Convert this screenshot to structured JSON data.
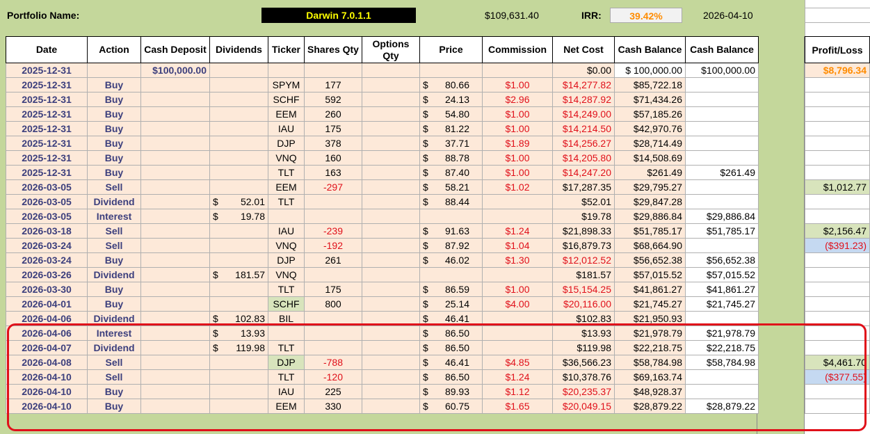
{
  "header": {
    "portfolio_label": "Portfolio Name:",
    "portfolio_name": "Darwin 7.0.1.1",
    "total_value": "$109,631.40",
    "irr_label": "IRR:",
    "irr_value": "39.42%",
    "as_of_date": "2026-04-10"
  },
  "columns": {
    "date": "Date",
    "action": "Action",
    "cash_deposit": "Cash Deposit",
    "dividends": "Dividends",
    "ticker": "Ticker",
    "shares": "Shares Qty",
    "options": "Options Qty",
    "price": "Price",
    "commission": "Commission",
    "net_cost": "Net Cost",
    "cash_balance1": "Cash Balance",
    "cash_balance2": "Cash Balance",
    "profit_loss": "Profit/Loss"
  },
  "rows": [
    {
      "date": "2025-12-31",
      "action": "",
      "deposit": "$100,000.00",
      "div": "",
      "div_amt": "",
      "ticker": "",
      "shares": "",
      "options": "",
      "price": "",
      "commission": "",
      "net_cost": "$0.00",
      "cash1": "$ 100,000.00",
      "cash2": "$100,000.00",
      "pl": "$8,796.34",
      "pl_type": "orange"
    },
    {
      "date": "2025-12-31",
      "action": "Buy",
      "deposit": "",
      "div": "",
      "div_amt": "",
      "ticker": "SPYM",
      "shares": "177",
      "options": "",
      "price": "80.66",
      "commission": "$1.00",
      "net_cost": "$14,277.82",
      "cash1": "$85,722.18",
      "cash2": "",
      "pl": "",
      "pl_type": ""
    },
    {
      "date": "2025-12-31",
      "action": "Buy",
      "deposit": "",
      "div": "",
      "div_amt": "",
      "ticker": "SCHF",
      "shares": "592",
      "options": "",
      "price": "24.13",
      "commission": "$2.96",
      "net_cost": "$14,287.92",
      "cash1": "$71,434.26",
      "cash2": "",
      "pl": "",
      "pl_type": ""
    },
    {
      "date": "2025-12-31",
      "action": "Buy",
      "deposit": "",
      "div": "",
      "div_amt": "",
      "ticker": "EEM",
      "shares": "260",
      "options": "",
      "price": "54.80",
      "commission": "$1.00",
      "net_cost": "$14,249.00",
      "cash1": "$57,185.26",
      "cash2": "",
      "pl": "",
      "pl_type": ""
    },
    {
      "date": "2025-12-31",
      "action": "Buy",
      "deposit": "",
      "div": "",
      "div_amt": "",
      "ticker": "IAU",
      "shares": "175",
      "options": "",
      "price": "81.22",
      "commission": "$1.00",
      "net_cost": "$14,214.50",
      "cash1": "$42,970.76",
      "cash2": "",
      "pl": "",
      "pl_type": ""
    },
    {
      "date": "2025-12-31",
      "action": "Buy",
      "deposit": "",
      "div": "",
      "div_amt": "",
      "ticker": "DJP",
      "shares": "378",
      "options": "",
      "price": "37.71",
      "commission": "$1.89",
      "net_cost": "$14,256.27",
      "cash1": "$28,714.49",
      "cash2": "",
      "pl": "",
      "pl_type": ""
    },
    {
      "date": "2025-12-31",
      "action": "Buy",
      "deposit": "",
      "div": "",
      "div_amt": "",
      "ticker": "VNQ",
      "shares": "160",
      "options": "",
      "price": "88.78",
      "commission": "$1.00",
      "net_cost": "$14,205.80",
      "cash1": "$14,508.69",
      "cash2": "",
      "pl": "",
      "pl_type": ""
    },
    {
      "date": "2025-12-31",
      "action": "Buy",
      "deposit": "",
      "div": "",
      "div_amt": "",
      "ticker": "TLT",
      "shares": "163",
      "options": "",
      "price": "87.40",
      "commission": "$1.00",
      "net_cost": "$14,247.20",
      "cash1": "$261.49",
      "cash2": "$261.49",
      "pl": "",
      "pl_type": ""
    },
    {
      "date": "2026-03-05",
      "action": "Sell",
      "deposit": "",
      "div": "",
      "div_amt": "",
      "ticker": "EEM",
      "shares": "-297",
      "options": "",
      "price": "58.21",
      "commission": "$1.02",
      "net_cost": "$17,287.35",
      "cash1": "$29,795.27",
      "cash2": "",
      "pl": "$1,012.77",
      "pl_type": "pos"
    },
    {
      "date": "2026-03-05",
      "action": "Dividend",
      "deposit": "",
      "div": "$",
      "div_amt": "52.01",
      "ticker": "TLT",
      "shares": "",
      "options": "",
      "price": "88.44",
      "commission": "",
      "net_cost": "$52.01",
      "cash1": "$29,847.28",
      "cash2": "",
      "pl": "",
      "pl_type": ""
    },
    {
      "date": "2026-03-05",
      "action": "Interest",
      "deposit": "",
      "div": "$",
      "div_amt": "19.78",
      "ticker": "",
      "shares": "",
      "options": "",
      "price": "",
      "commission": "",
      "net_cost": "$19.78",
      "cash1": "$29,886.84",
      "cash2": "$29,886.84",
      "pl": "",
      "pl_type": ""
    },
    {
      "date": "2026-03-18",
      "action": "Sell",
      "deposit": "",
      "div": "",
      "div_amt": "",
      "ticker": "IAU",
      "shares": "-239",
      "options": "",
      "price": "91.63",
      "commission": "$1.24",
      "net_cost": "$21,898.33",
      "cash1": "$51,785.17",
      "cash2": "$51,785.17",
      "pl": "$2,156.47",
      "pl_type": "pos"
    },
    {
      "date": "2026-03-24",
      "action": "Sell",
      "deposit": "",
      "div": "",
      "div_amt": "",
      "ticker": "VNQ",
      "shares": "-192",
      "options": "",
      "price": "87.92",
      "commission": "$1.04",
      "net_cost": "$16,879.73",
      "cash1": "$68,664.90",
      "cash2": "",
      "pl": "($391.23)",
      "pl_type": "neg"
    },
    {
      "date": "2026-03-24",
      "action": "Buy",
      "deposit": "",
      "div": "",
      "div_amt": "",
      "ticker": "DJP",
      "shares": "261",
      "options": "",
      "price": "46.02",
      "commission": "$1.30",
      "net_cost": "$12,012.52",
      "cash1": "$56,652.38",
      "cash2": "$56,652.38",
      "pl": "",
      "pl_type": ""
    },
    {
      "date": "2026-03-26",
      "action": "Dividend",
      "deposit": "",
      "div": "$",
      "div_amt": "181.57",
      "ticker": "VNQ",
      "shares": "",
      "options": "",
      "price": "",
      "commission": "",
      "net_cost": "$181.57",
      "cash1": "$57,015.52",
      "cash2": "$57,015.52",
      "pl": "",
      "pl_type": ""
    },
    {
      "date": "2026-03-30",
      "action": "Buy",
      "deposit": "",
      "div": "",
      "div_amt": "",
      "ticker": "TLT",
      "shares": "175",
      "options": "",
      "price": "86.59",
      "commission": "$1.00",
      "net_cost": "$15,154.25",
      "cash1": "$41,861.27",
      "cash2": "$41,861.27",
      "pl": "",
      "pl_type": ""
    },
    {
      "date": "2026-04-01",
      "action": "Buy",
      "deposit": "",
      "div": "",
      "div_amt": "",
      "ticker": "SCHF",
      "shares": "800",
      "options": "",
      "price": "25.14",
      "commission": "$4.00",
      "net_cost": "$20,116.00",
      "cash1": "$21,745.27",
      "cash2": "$21,745.27",
      "pl": "",
      "pl_type": "",
      "ticker_green": true
    },
    {
      "date": "2026-04-06",
      "action": "Dividend",
      "deposit": "",
      "div": "$",
      "div_amt": "102.83",
      "ticker": "BIL",
      "shares": "",
      "options": "",
      "price": "46.41",
      "commission": "",
      "net_cost": "$102.83",
      "cash1": "$21,950.93",
      "cash2": "",
      "pl": "",
      "pl_type": ""
    },
    {
      "date": "2026-04-06",
      "action": "Interest",
      "deposit": "",
      "div": "$",
      "div_amt": "13.93",
      "ticker": "",
      "shares": "",
      "options": "",
      "price": "86.50",
      "commission": "",
      "net_cost": "$13.93",
      "cash1": "$21,978.79",
      "cash2": "$21,978.79",
      "pl": "",
      "pl_type": ""
    },
    {
      "date": "2026-04-07",
      "action": "Dividend",
      "deposit": "",
      "div": "$",
      "div_amt": "119.98",
      "ticker": "TLT",
      "shares": "",
      "options": "",
      "price": "86.50",
      "commission": "",
      "net_cost": "$119.98",
      "cash1": "$22,218.75",
      "cash2": "$22,218.75",
      "pl": "",
      "pl_type": ""
    },
    {
      "date": "2026-04-08",
      "action": "Sell",
      "deposit": "",
      "div": "",
      "div_amt": "",
      "ticker": "DJP",
      "shares": "-788",
      "options": "",
      "price": "46.41",
      "commission": "$4.85",
      "net_cost": "$36,566.23",
      "cash1": "$58,784.98",
      "cash2": "$58,784.98",
      "pl": "$4,461.70",
      "pl_type": "pos",
      "ticker_green": true
    },
    {
      "date": "2026-04-10",
      "action": "Sell",
      "deposit": "",
      "div": "",
      "div_amt": "",
      "ticker": "TLT",
      "shares": "-120",
      "options": "",
      "price": "86.50",
      "commission": "$1.24",
      "net_cost": "$10,378.76",
      "cash1": "$69,163.74",
      "cash2": "",
      "pl": "($377.55)",
      "pl_type": "neg"
    },
    {
      "date": "2026-04-10",
      "action": "Buy",
      "deposit": "",
      "div": "",
      "div_amt": "",
      "ticker": "IAU",
      "shares": "225",
      "options": "",
      "price": "89.93",
      "commission": "$1.12",
      "net_cost": "$20,235.37",
      "cash1": "$48,928.37",
      "cash2": "",
      "pl": "",
      "pl_type": ""
    },
    {
      "date": "2026-04-10",
      "action": "Buy",
      "deposit": "",
      "div": "",
      "div_amt": "",
      "ticker": "EEM",
      "shares": "330",
      "options": "",
      "price": "60.75",
      "commission": "$1.65",
      "net_cost": "$20,049.15",
      "cash1": "$28,879.22",
      "cash2": "$28,879.22",
      "pl": "",
      "pl_type": ""
    }
  ],
  "colors": {
    "header_bg": "#c4d79b",
    "row_bg": "#fde9d9",
    "negative": "#e0101a",
    "action_text": "#3c3f7d",
    "highlight_border": "#e0101a"
  }
}
